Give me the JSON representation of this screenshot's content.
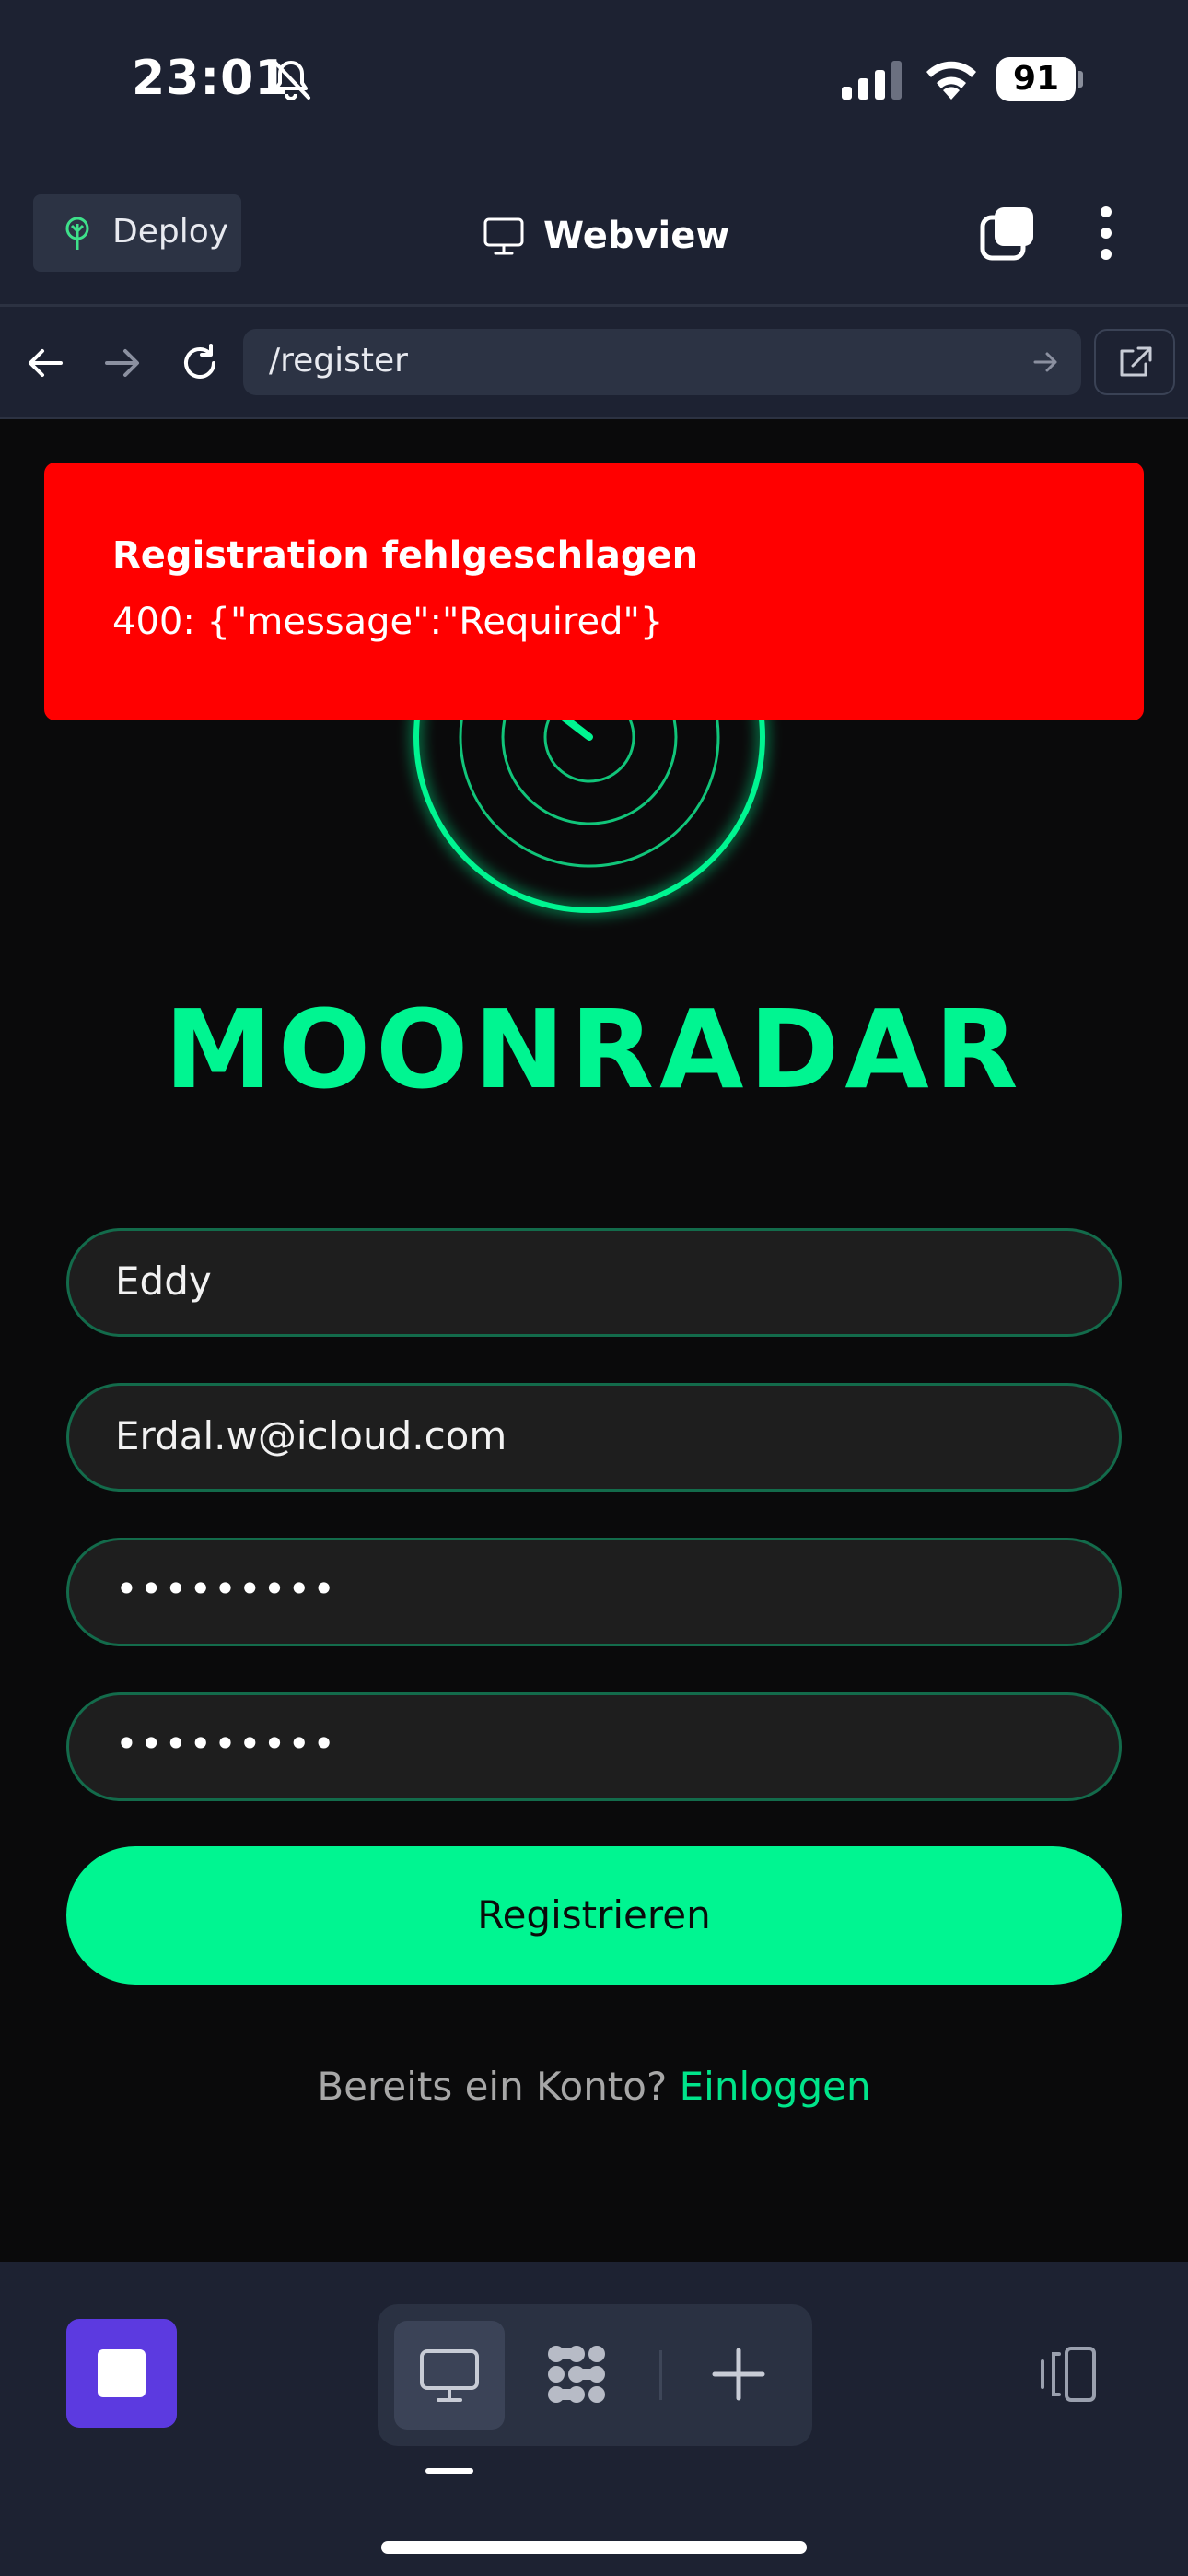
{
  "status_bar": {
    "time": "23:01",
    "battery": "91",
    "icons": [
      "bell-slash-icon",
      "cellular-signal-icon",
      "wifi-icon",
      "battery-icon"
    ]
  },
  "app_bar": {
    "deploy_label": "Deploy",
    "title": "Webview",
    "icons": [
      "tree-icon",
      "monitor-icon",
      "tabs-icon",
      "more-vertical-icon"
    ]
  },
  "url_bar": {
    "url": "/register",
    "icons": [
      "back-arrow-icon",
      "forward-arrow-icon",
      "reload-icon",
      "go-arrow-icon",
      "external-link-icon"
    ]
  },
  "toast": {
    "title": "Registration fehlgeschlagen",
    "message": "400: {\"message\":\"Required\"}"
  },
  "brand": {
    "name": "MOONRADAR",
    "icon": "radar-icon"
  },
  "form": {
    "username": "Eddy",
    "email": "Erdal.w@icloud.com",
    "password_mask": "•••••••••",
    "confirm_password_mask": "•••••••••",
    "submit_label": "Registrieren"
  },
  "login_prompt": {
    "question": "Bereits ein Konto?",
    "link": "Einloggen"
  },
  "bottom_bar": {
    "icons": [
      "stop-icon",
      "monitor-icon",
      "workflow-icon",
      "plus-icon",
      "devices-icon"
    ]
  },
  "colors": {
    "accent_green": "#00f591",
    "error_red": "#ff0000",
    "app_chrome": "#1d2232",
    "page_background": "#0a0a0b",
    "stop_purple": "#5c3ae0"
  }
}
